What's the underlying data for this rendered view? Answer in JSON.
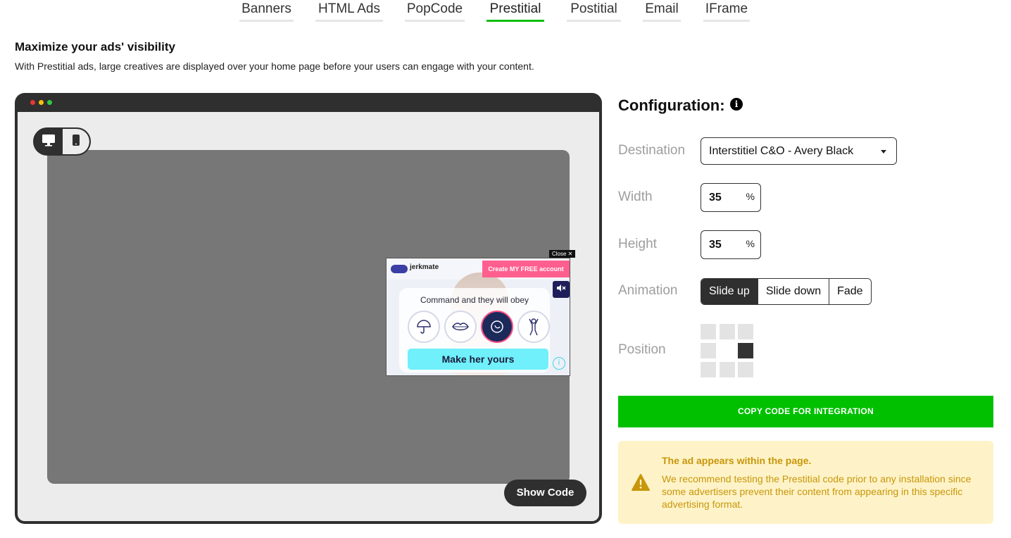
{
  "tabs": [
    {
      "label": "Banners"
    },
    {
      "label": "HTML Ads"
    },
    {
      "label": "PopCode"
    },
    {
      "label": "Prestitial",
      "active": true
    },
    {
      "label": "Postitial"
    },
    {
      "label": "Email"
    },
    {
      "label": "IFrame"
    }
  ],
  "intro": {
    "title": "Maximize your ads' visibility",
    "description": "With Prestitial ads, large creatives are displayed over your home page before your users can engage with your content."
  },
  "preview": {
    "device_icons": [
      "desktop-icon",
      "mobile-icon"
    ],
    "active_device": "desktop",
    "ad": {
      "close_label": "Close ✕",
      "logo": "jerkmate",
      "top_cta": "Create MY FREE account",
      "headline": "Command and they will obey",
      "cta": "Make her yours"
    },
    "show_code_label": "Show Code"
  },
  "config": {
    "title": "Configuration:",
    "destination": {
      "label": "Destination",
      "value": "Interstitiel C&O - Avery Black"
    },
    "width": {
      "label": "Width",
      "value": "35",
      "unit": "%"
    },
    "height": {
      "label": "Height",
      "value": "35",
      "unit": "%"
    },
    "animation": {
      "label": "Animation",
      "options": [
        "Slide up",
        "Slide down",
        "Fade"
      ],
      "selected": "Slide up"
    },
    "position": {
      "label": "Position",
      "selected": "middle-right"
    },
    "copy_button": "COPY CODE FOR INTEGRATION"
  },
  "warning": {
    "title": "The ad appears within the page.",
    "text": "We recommend testing the Prestitial code prior to any installation since some advertisers prevent their content from appearing in this specific advertising format."
  },
  "colors": {
    "accent_green": "#00c000",
    "tab_active": "#0fbe0f",
    "warning_bg": "#fef3c8",
    "warning_text": "#c8960a",
    "dark": "#2f2f2f"
  }
}
